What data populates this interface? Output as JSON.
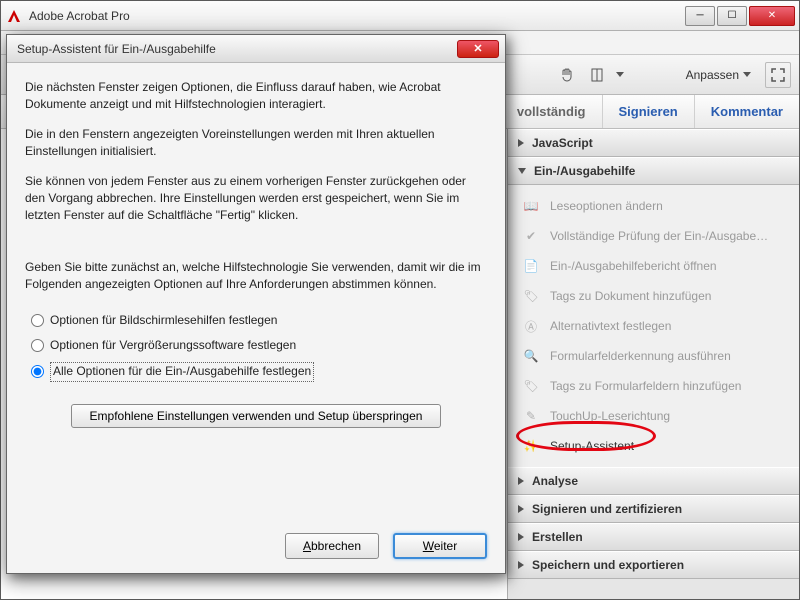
{
  "app": {
    "title": "Adobe Acrobat Pro"
  },
  "toolbar": {
    "customize": "Anpassen"
  },
  "tabs": {
    "vollstaendig": "vollständig",
    "signieren": "Signieren",
    "kommentar": "Kommentar"
  },
  "panel": {
    "sections": {
      "javascript": "JavaScript",
      "accessibility": "Ein-/Ausgabehilfe",
      "analyse": "Analyse",
      "signieren": "Signieren und zertifizieren",
      "erstellen": "Erstellen",
      "speichern": "Speichern und exportieren"
    },
    "tools": {
      "leseoptionen": "Leseoptionen ändern",
      "pruefung": "Vollständige Prüfung der Ein-/Ausgabe…",
      "bericht": "Ein-/Ausgabehilfebericht öffnen",
      "tagsdoc": "Tags zu Dokument hinzufügen",
      "alttext": "Alternativtext festlegen",
      "formfeld": "Formularfelderkennung ausführen",
      "tagsform": "Tags zu Formularfeldern hinzufügen",
      "touchup": "TouchUp-Leserichtung",
      "setup": "Setup-Assistent"
    }
  },
  "dialog": {
    "title": "Setup-Assistent für Ein-/Ausgabehilfe",
    "p1": "Die nächsten Fenster zeigen Optionen, die Einfluss darauf haben, wie Acrobat Dokumente anzeigt und mit Hilfstechnologien interagiert.",
    "p2": "Die in den Fenstern angezeigten Voreinstellungen werden mit Ihren aktuellen Einstellungen initialisiert.",
    "p3": "Sie können von jedem Fenster aus zu einem vorherigen Fenster zurückgehen oder den Vorgang abbrechen. Ihre Einstellungen werden erst gespeichert, wenn Sie im letzten Fenster auf die Schaltfläche \"Fertig\" klicken.",
    "p4": "Geben Sie bitte zunächst an, welche Hilfstechnologie Sie verwenden, damit wir die im Folgenden angezeigten Optionen auf Ihre Anforderungen abstimmen können.",
    "radios": {
      "screenreader": "Optionen für Bildschirmlesehilfen festlegen",
      "magnifier": "Optionen für Vergrößerungssoftware festlegen",
      "all": "Alle Optionen für die Ein-/Ausgabehilfe festlegen"
    },
    "recommended": "Empfohlene Einstellungen verwenden und Setup überspringen",
    "buttons": {
      "cancel_pre": "A",
      "cancel_rest": "bbrechen",
      "next_pre": "W",
      "next_rest": "eiter"
    }
  }
}
